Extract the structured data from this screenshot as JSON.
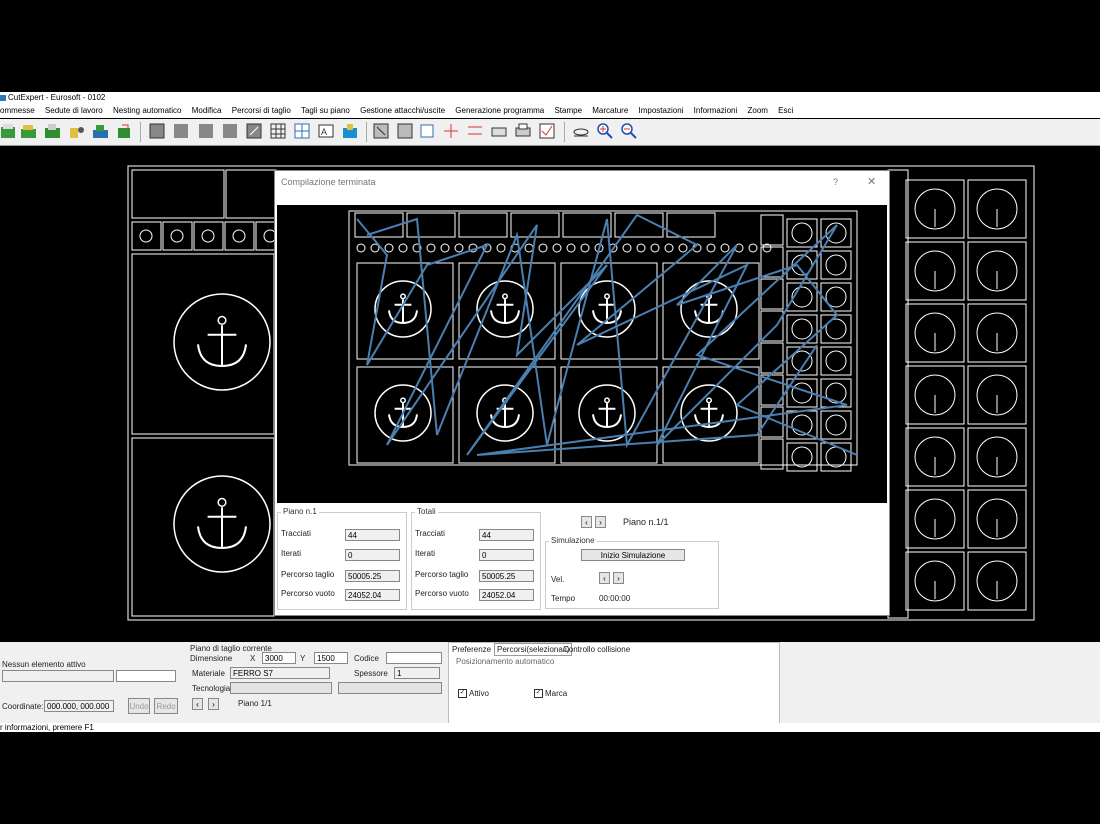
{
  "window": {
    "title": "CutExpert - Eurosoft - 0102"
  },
  "menu": [
    "ommesse",
    "Sedute di lavoro",
    "Nesting automatico",
    "Modifica",
    "Percorsi di taglio",
    "Tagli su piano",
    "Gestione attacchi/uscite",
    "Generazione programma",
    "Stampe",
    "Marcature",
    "Impostazioni",
    "Informazioni",
    "Zoom",
    "Esci"
  ],
  "dialog": {
    "title": "Compilazione terminata",
    "help": "?",
    "close": "✕",
    "piano": {
      "group": "Piano n.1",
      "tracciati_label": "Tracciati",
      "tracciati": "44",
      "iterazioni_label": "Iterati",
      "iterazioni": "0",
      "percorso_taglio_label": "Percorso taglio",
      "percorso_taglio": "50005.25",
      "percorso_vuoto_label": "Percorso vuoto",
      "percorso_vuoto": "24052.04"
    },
    "totali": {
      "group": "Totali",
      "tracciati_label": "Tracciati",
      "tracciati": "44",
      "iterazioni_label": "Iterati",
      "iterazioni": "0",
      "percorso_taglio_label": "Percorso taglio",
      "percorso_taglio": "50005.25",
      "percorso_vuoto_label": "Percorso vuoto",
      "percorso_vuoto": "24052.04"
    },
    "piano_nav": "Piano n.1/1",
    "simulazione": {
      "group": "Simulazione",
      "start": "Inizio Simulazione",
      "vel_label": "Vel.",
      "tempo_label": "Tempo",
      "tempo": "00:00:00"
    }
  },
  "bottom": {
    "nessun_label": "Nessun elemento attivo",
    "coord_label": "Coordinate:",
    "coord": "000.000, 000.000",
    "undo": "Undo",
    "redo": "Redo",
    "piano_group": "Piano di taglio corrente",
    "dimensione_label": "Dimensione",
    "x_label": "X",
    "dim_x": "3000",
    "y_label": "Y",
    "dim_y": "1500",
    "codice_label": "Codice",
    "materiale_label": "Materiale",
    "materiale": "FERRO S7",
    "spessore_label": "Spessore",
    "spessore": "1",
    "tecnologia_label": "Tecnologia",
    "piano_num": "Piano 1/1",
    "tabs": [
      "Preferenze",
      "Percorsi(seleziona/i)",
      "Controllo collisione"
    ],
    "note": "Posizionamento automatico",
    "attivo": "Attivo",
    "marca": "Marca"
  },
  "status": {
    "text": "r informazioni, premere F1"
  },
  "colors": {
    "path": "#4a7fb0",
    "cad": "#ffffff",
    "bg": "#000000"
  }
}
